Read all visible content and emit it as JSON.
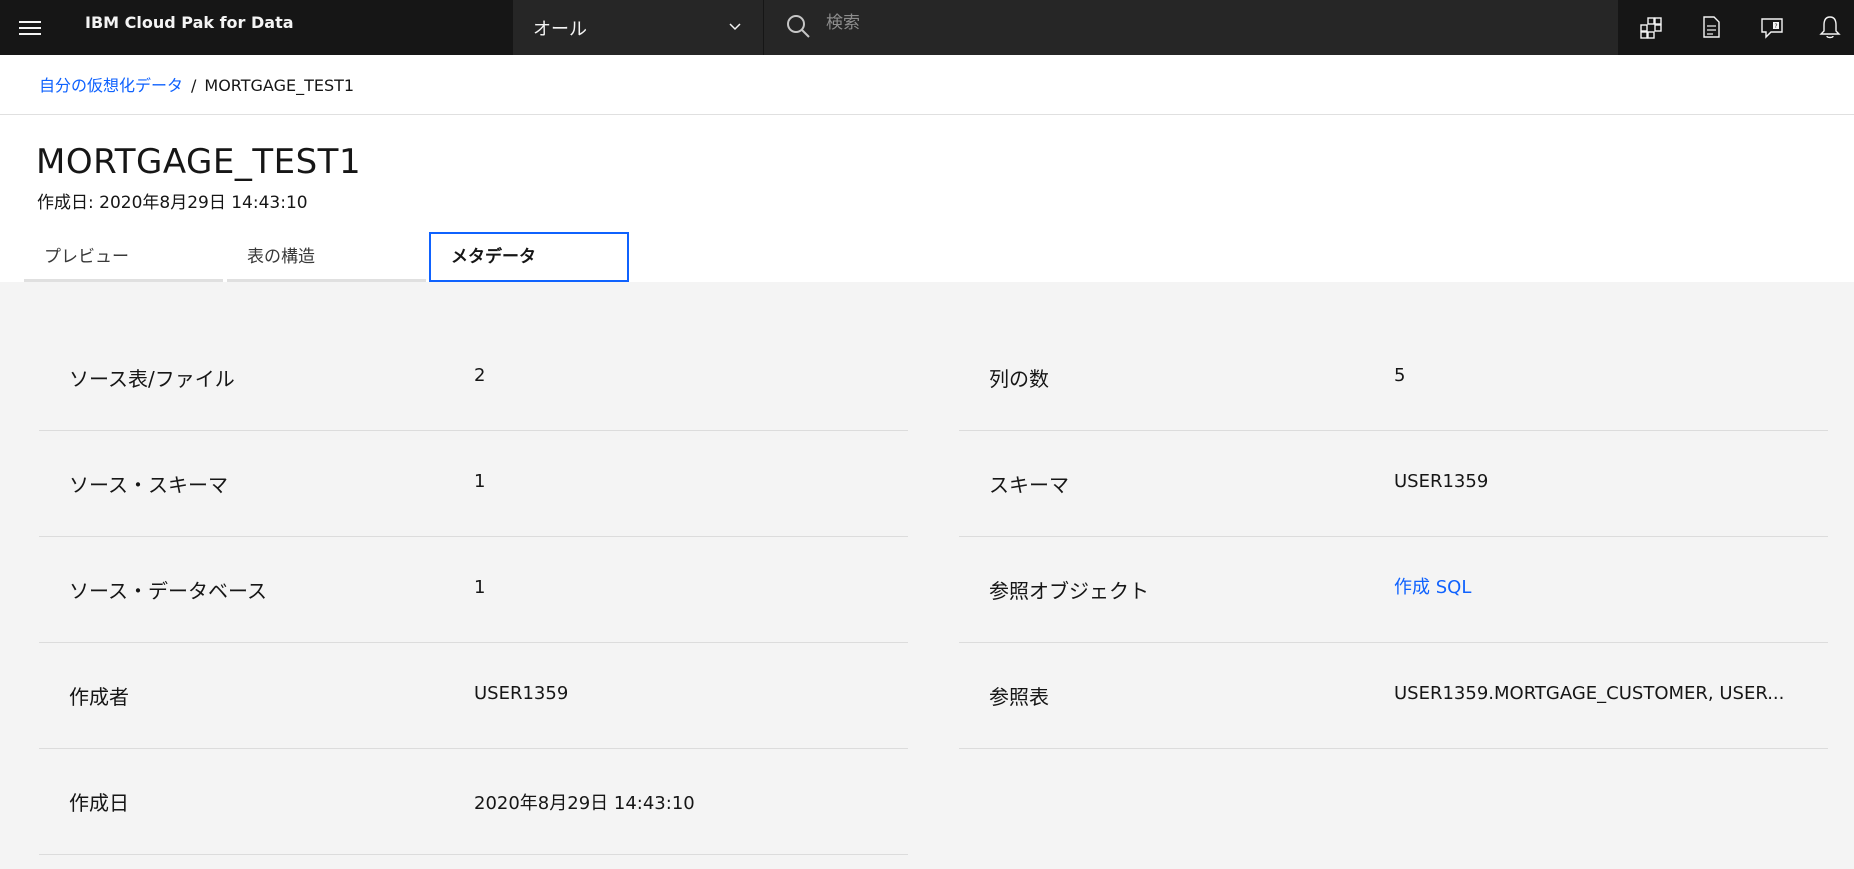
{
  "header": {
    "brand": "IBM Cloud Pak for Data",
    "scope": "オール",
    "search_placeholder": "検索"
  },
  "breadcrumb": {
    "parent": "自分の仮想化データ",
    "separator": "/",
    "current": "MORTGAGE_TEST1"
  },
  "page": {
    "title": "MORTGAGE_TEST1",
    "created": "作成日: 2020年8月29日 14:43:10"
  },
  "tabs": [
    {
      "label": "プレビュー",
      "active": false
    },
    {
      "label": "表の構造",
      "active": false
    },
    {
      "label": "メタデータ",
      "active": true
    }
  ],
  "metadata": {
    "left": [
      {
        "label": "ソース表/ファイル",
        "value": "2"
      },
      {
        "label": "ソース・スキーマ",
        "value": "1"
      },
      {
        "label": "ソース・データベース",
        "value": "1"
      },
      {
        "label": "作成者",
        "value": "USER1359"
      },
      {
        "label": "作成日",
        "value": "2020年8月29日 14:43:10"
      }
    ],
    "right": [
      {
        "label": "列の数",
        "value": "5"
      },
      {
        "label": "スキーマ",
        "value": "USER1359"
      },
      {
        "label": "参照オブジェクト",
        "value": "作成 SQL"
      },
      {
        "label": "参照表",
        "value": "USER1359.MORTGAGE_CUSTOMER, USER..."
      }
    ]
  },
  "colors": {
    "header_bg": "#161616",
    "link": "#0f62fe",
    "panel_bg": "#f4f4f4"
  },
  "icons": [
    "hamburger-menu-icon",
    "chevron-down-icon",
    "search-icon",
    "catalog-icon",
    "document-icon",
    "help-chat-icon",
    "notification-bell-icon"
  ]
}
